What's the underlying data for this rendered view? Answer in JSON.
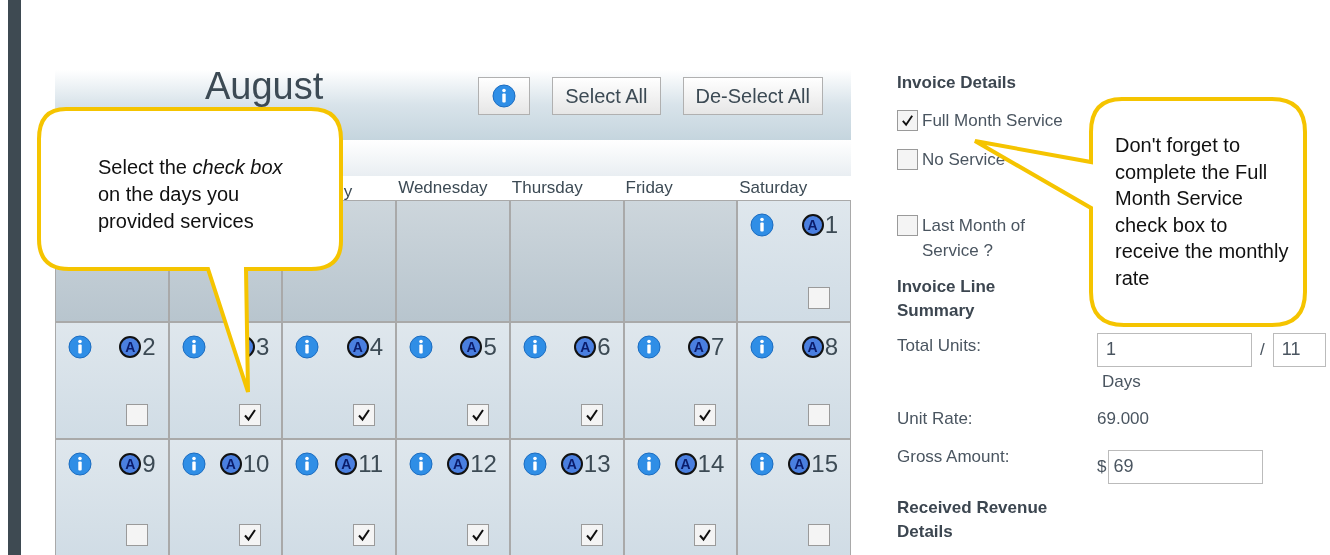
{
  "calendar": {
    "title": "August",
    "buttons": [
      {
        "kind": "info"
      },
      {
        "kind": "text",
        "label": "Select All"
      },
      {
        "kind": "text",
        "label": "De-Select All"
      }
    ],
    "weekdays": [
      "y",
      "Wednesday",
      "Thursday",
      "Friday",
      "Saturday"
    ],
    "weeks": [
      [
        {
          "kind": "blank"
        },
        {
          "kind": "blank"
        },
        {
          "kind": "blank"
        },
        {
          "kind": "blank"
        },
        {
          "kind": "blank"
        },
        {
          "kind": "blank"
        },
        {
          "kind": "day",
          "badge": "A",
          "day": "1",
          "checked": false
        }
      ],
      [
        {
          "kind": "day",
          "badge": "A",
          "day": "2",
          "checked": false
        },
        {
          "kind": "day",
          "day": "3",
          "checked": true
        },
        {
          "kind": "day",
          "badge": "A",
          "day": "4",
          "checked": true
        },
        {
          "kind": "day",
          "badge": "A",
          "day": "5",
          "checked": true
        },
        {
          "kind": "day",
          "badge": "A",
          "day": "6",
          "checked": true
        },
        {
          "kind": "day",
          "badge": "A",
          "day": "7",
          "checked": true
        },
        {
          "kind": "day",
          "badge": "A",
          "day": "8",
          "checked": false
        }
      ],
      [
        {
          "kind": "day",
          "badge": "A",
          "day": "9",
          "checked": false
        },
        {
          "kind": "day",
          "badge": "A",
          "day": "10",
          "checked": true
        },
        {
          "kind": "day",
          "badge": "A",
          "day": "11",
          "checked": true
        },
        {
          "kind": "day",
          "badge": "A",
          "day": "12",
          "checked": true
        },
        {
          "kind": "day",
          "badge": "A",
          "day": "13",
          "checked": true
        },
        {
          "kind": "day",
          "badge": "A",
          "day": "14",
          "checked": true
        },
        {
          "kind": "day",
          "badge": "A",
          "day": "15",
          "checked": false
        }
      ]
    ]
  },
  "invoice": {
    "title": "Invoice Details",
    "options": [
      {
        "label": "Full Month Service",
        "checked": true
      },
      {
        "label": "No Service",
        "checked": false
      },
      {
        "label": "Last Month of Service ?",
        "checked": false
      }
    ],
    "summary_title": "Invoice Line Summary",
    "total_units": {
      "label": "Total Units:",
      "value": "1",
      "separator": "/",
      "max": "11",
      "unit": "Days"
    },
    "unit_rate": {
      "label": "Unit Rate:",
      "value": "69.000"
    },
    "gross_amount": {
      "label": "Gross Amount:",
      "currency": "$",
      "value": "69"
    },
    "revenue_title": "Received Revenue Details"
  },
  "callouts": [
    {
      "text": "Select the *check box* on the days you provided services"
    },
    {
      "text": "Don't forget to complete the Full Month Service check box to receive the monthly rate"
    }
  ]
}
